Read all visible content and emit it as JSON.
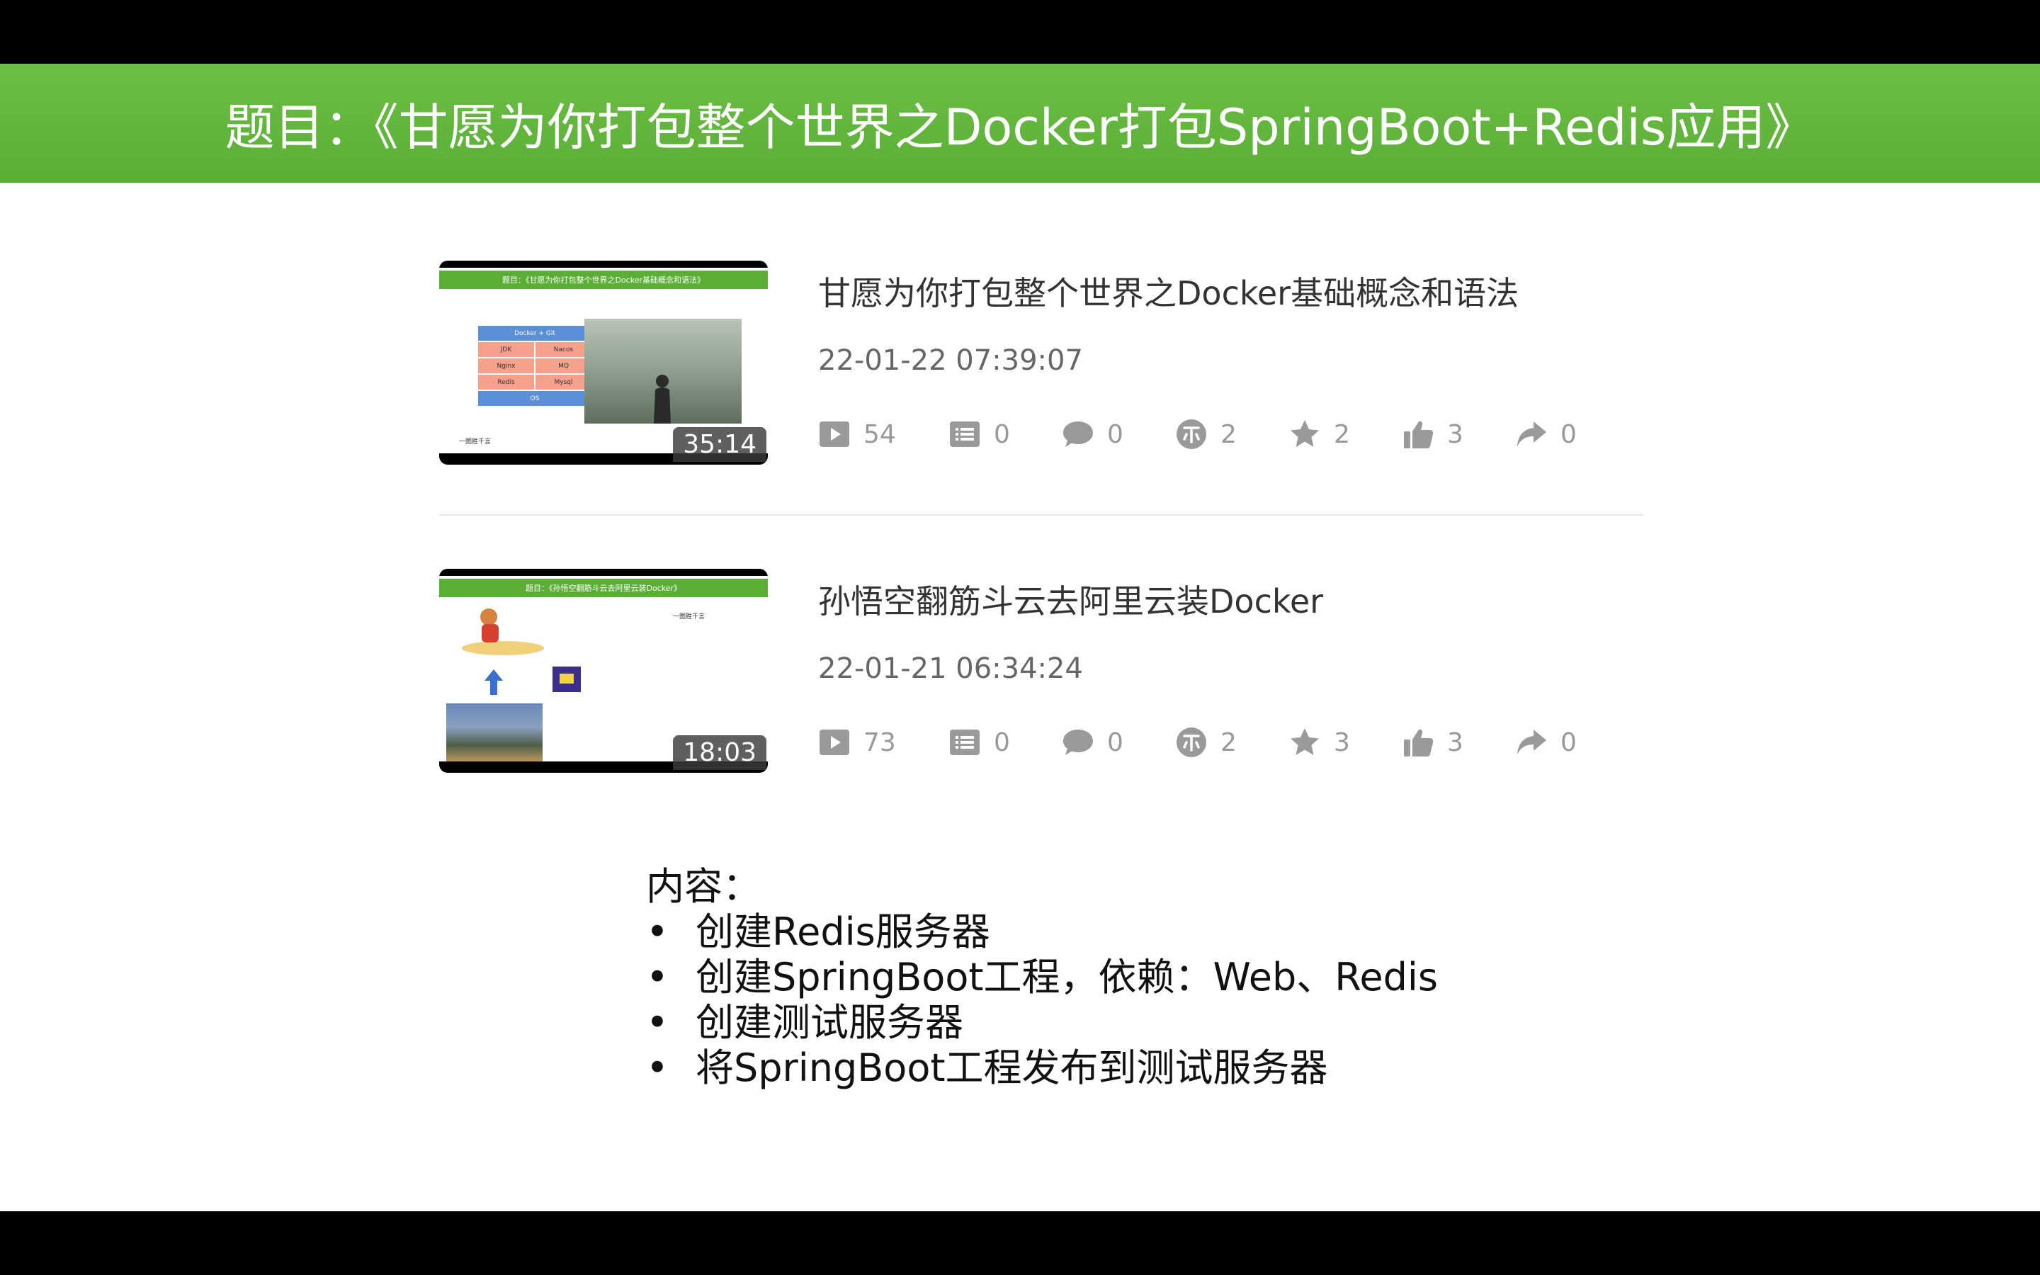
{
  "slide": {
    "title": "题目：《甘愿为你打包整个世界之Docker打包SpringBoot+Redis应用》"
  },
  "videos": [
    {
      "thumb_header": "题目：《甘愿为你打包整个世界之Docker基础概念和语法》",
      "thumb_table": [
        "Docker + Git",
        "JDK",
        "Nacos",
        "Nginx",
        "MQ",
        "Redis",
        "Mysql",
        "OS"
      ],
      "thumb_caption": "一图胜千言",
      "duration": "35:14",
      "title": "甘愿为你打包整个世界之Docker基础概念和语法",
      "date": "22-01-22 07:39:07",
      "stats": {
        "plays": "54",
        "danmaku": "0",
        "comments": "0",
        "coins": "2",
        "favorites": "2",
        "likes": "3",
        "shares": "0"
      }
    },
    {
      "thumb_header": "题目：《孙悟空翻筋斗云去阿里云装Docker》",
      "thumb_note": "一图胜千言",
      "duration": "18:03",
      "title": "孙悟空翻筋斗云去阿里云装Docker",
      "date": "22-01-21 06:34:24",
      "stats": {
        "plays": "73",
        "danmaku": "0",
        "comments": "0",
        "coins": "2",
        "favorites": "3",
        "likes": "3",
        "shares": "0"
      }
    }
  ],
  "content": {
    "heading": "内容：",
    "bullet": "•",
    "items": [
      "创建Redis服务器",
      "创建SpringBoot工程，依赖：Web、Redis",
      "创建测试服务器",
      "将SpringBoot工程发布到测试服务器"
    ]
  },
  "colors": {
    "title_bar": "#5aae36",
    "stat_icon": "#9a9a9a",
    "background": "#ffffff"
  },
  "icons": [
    "play-icon",
    "danmaku-icon",
    "comment-icon",
    "coin-icon",
    "star-icon",
    "thumbs-up-icon",
    "share-icon"
  ]
}
